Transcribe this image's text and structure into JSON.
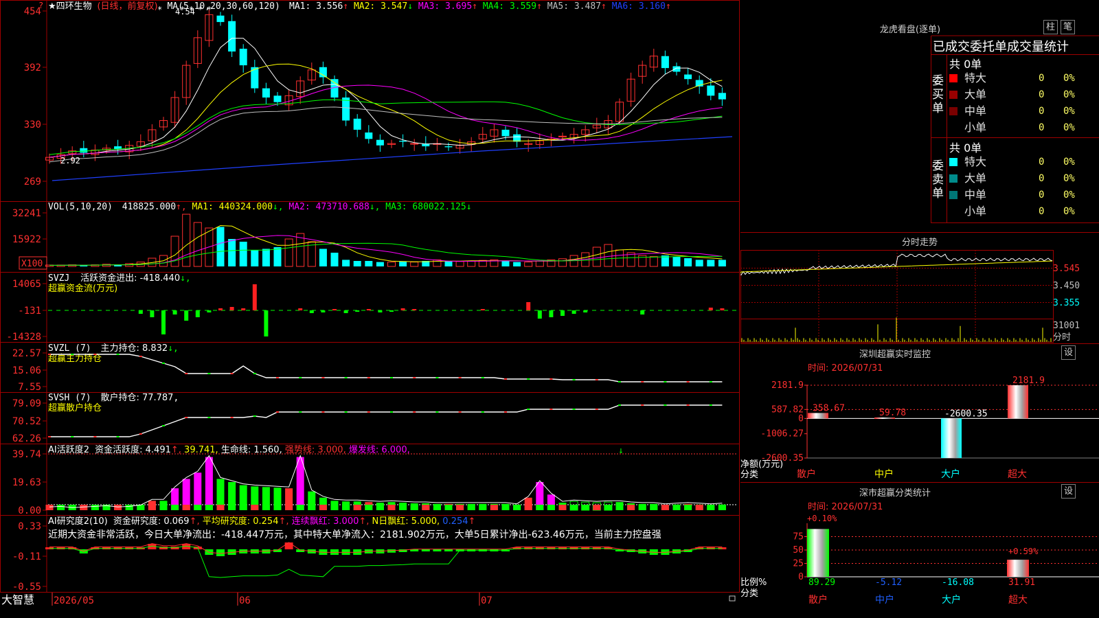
{
  "main": {
    "stock_name": "四环生物",
    "period_note": "(日线，前复权)",
    "ma_params": "MA(5,10,20,30,60,120)",
    "ma_items": [
      {
        "label": "MA1: 3.556",
        "arrow": "↑",
        "color": "#ffffff"
      },
      {
        "label": "MA2: 3.547",
        "arrow": "↓",
        "color": "#ffff00"
      },
      {
        "label": "MA3: 3.695",
        "arrow": "↑",
        "color": "#ff00ff"
      },
      {
        "label": "MA4: 3.559",
        "arrow": "↑",
        "color": "#00ff00"
      },
      {
        "label": "MA5: 3.487",
        "arrow": "↑",
        "color": "#c0c0c0"
      },
      {
        "label": "MA6: 3.160",
        "arrow": "↑",
        "color": "#2040ff"
      }
    ],
    "y_labels": [
      "454",
      "392",
      "330",
      "269"
    ],
    "high_mark": "4.54",
    "low_mark": "2.92",
    "stars": "★"
  },
  "vol": {
    "params": "VOL(5,10,20)",
    "value": "418825.000",
    "ma1": "MA1: 440324.000",
    "ma2": "MA2: 473710.688",
    "ma3": "MA3: 680022.125",
    "y_labels": [
      "32241",
      "15922"
    ],
    "unit": "X100"
  },
  "svzj": {
    "name": "SVZJ",
    "item": "活跃资金进出: -418.440",
    "subtitle": "超赢资金流(万元)",
    "y_labels": [
      "14065",
      "-131",
      "-14328"
    ]
  },
  "svzl": {
    "name": "SVZL (7)",
    "item": "主力持仓: 8.832",
    "subtitle": "超赢主力持仓",
    "y_labels": [
      "22.57",
      "15.06",
      "7.55"
    ]
  },
  "svsh": {
    "name": "SVSH (7)",
    "item": "散户持仓: 77.787",
    "subtitle": "超赢散户持仓",
    "y_labels": [
      "79.09",
      "70.52",
      "62.26"
    ]
  },
  "ai1": {
    "name": "AI活跃度2",
    "item1": "资金活跃度: 4.491",
    "item2": "39.741",
    "item3": "生命线: 1.560",
    "item4": "强势线: 3.000",
    "item5": "爆发线: 6.000",
    "y_labels": [
      "39.74",
      "19.63",
      "0.00"
    ]
  },
  "ai2": {
    "name": "AI研究度2(10)",
    "item1": "资金研究度: 0.069",
    "item2": "平均研究度: 0.254",
    "item3": "连续飘红: 3.000",
    "item4": "N日飘红: 5.000",
    "item5": "0.254",
    "comment": "近期大资金非常活跃，今日大单净流出：-418.447万元，其中特大单净流入：2181.902万元，大单5日累计净出-623.46万元，当前主力控盘强",
    "y_labels": [
      "0.33",
      "-0.11",
      "-0.55"
    ]
  },
  "xaxis": {
    "brand": "大智慧",
    "labels": [
      "2026/05",
      "06",
      "07"
    ]
  },
  "dragon": {
    "title": "龙虎看盘(逐单)",
    "btn1": "柱",
    "btn2": "笔",
    "header": "已成交委托单成交量统计",
    "buy_side": "委买单",
    "sell_side": "委卖单",
    "buy_total": "共 0单",
    "sell_total": "共 0单",
    "buy_rows": [
      {
        "label": "特大",
        "v": "0",
        "p": "0%",
        "color": "#ff0000"
      },
      {
        "label": "大单",
        "v": "0",
        "p": "0%",
        "color": "#990000"
      },
      {
        "label": "中单",
        "v": "0",
        "p": "0%",
        "color": "#7a0000"
      },
      {
        "label": "小单",
        "v": "0",
        "p": "0%",
        "color": "#000000"
      }
    ],
    "sell_rows": [
      {
        "label": "特大",
        "v": "0",
        "p": "0%",
        "color": "#00ffff"
      },
      {
        "label": "大单",
        "v": "0",
        "p": "0%",
        "color": "#008b8b"
      },
      {
        "label": "中单",
        "v": "0",
        "p": "0%",
        "color": "#007777"
      },
      {
        "label": "小单",
        "v": "0",
        "p": "0%",
        "color": "#000000"
      }
    ]
  },
  "intraday": {
    "title": "分时走势",
    "y_labels": [
      "3.545",
      "3.450",
      "3.355"
    ],
    "vol_label": "31001",
    "vol_unit": "分时"
  },
  "sz_monitor": {
    "title": "深圳超赢实时监控",
    "btn": "设",
    "time": "时间: 2026/07/31",
    "y_labels": [
      "2181.9",
      "587.82",
      "0",
      "-1006.27",
      "-2600.35"
    ],
    "y_unit": "净额(万元)",
    "x_unit": "分类",
    "categories": [
      "散户",
      "中户",
      "大户",
      "超大"
    ],
    "values": [
      358.67,
      59.78,
      -2600.35,
      2181.9
    ],
    "value_labels": [
      "358.67",
      "59.78",
      "-2600.35",
      "2181.9"
    ]
  },
  "sz_class": {
    "title": "深市超赢分类统计",
    "btn": "设",
    "time": "时间: 2026/07/31",
    "y_labels": [
      "75",
      "50",
      "25",
      "0"
    ],
    "y_unit": "比例%",
    "x_unit": "分类",
    "categories": [
      "散户",
      "中户",
      "大户",
      "超大"
    ],
    "values": [
      89.29,
      -5.12,
      -16.08,
      31.91
    ],
    "value_labels": [
      "89.29",
      "-5.12",
      "-16.08",
      "31.91"
    ],
    "tag1": "+0.10%",
    "tag2": "+0.59%"
  }
}
